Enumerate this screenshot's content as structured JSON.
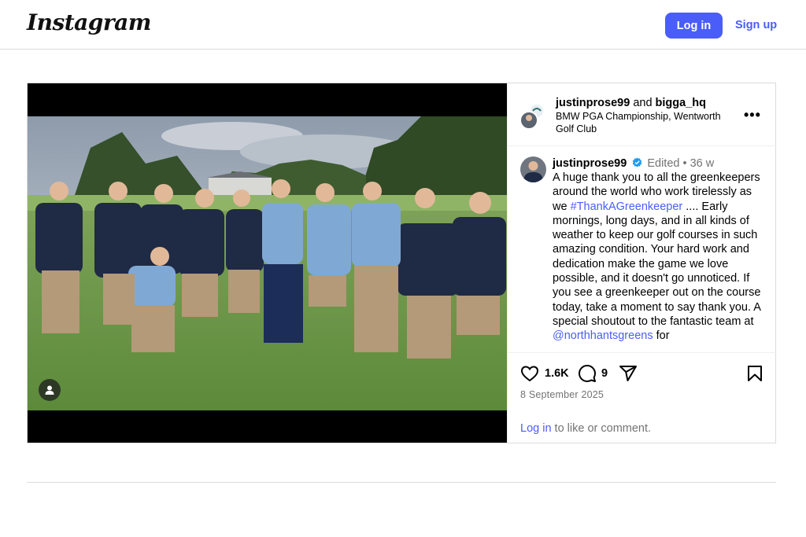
{
  "header": {
    "logo_text": "Instagram",
    "login_label": "Log in",
    "signup_label": "Sign up",
    "accent_color": "#4a5df9"
  },
  "post": {
    "author": "justinprose99",
    "connector": "and",
    "coauthor": "bigga_hq",
    "location": "BMW PGA Championship, Wentworth Golf Club",
    "more_icon": "more-horizontal-icon",
    "caption": {
      "username": "justinprose99",
      "edited": "Edited",
      "separator": "•",
      "age": "36 w",
      "text_before_hashtag": "A huge thank you to all the greenkeepers around the world who work tirelessly as we",
      "hashtag": "#ThankAGreenkeeper",
      "text_after_hashtag": ".... Early mornings, long days, and in all kinds of weather to keep our golf courses in such amazing condition. Your hard work and dedication make the game we love possible, and it doesn't go unnoticed. If you see a greenkeeper out on the course today, take a moment to say thank you. A special shoutout to the fantastic team at",
      "mention": "@northhantsgreens",
      "text_after_mention": "for"
    },
    "likes": "1.6K",
    "comments": "9",
    "date": "8 September 2025",
    "login_prompt_link": "Log in",
    "login_prompt_text": "to like or comment.",
    "icons": {
      "like": "heart-icon",
      "comment": "comment-icon",
      "share": "share-icon",
      "save": "bookmark-icon",
      "tag": "user-tag-icon",
      "verified": "verified-badge-icon"
    }
  }
}
